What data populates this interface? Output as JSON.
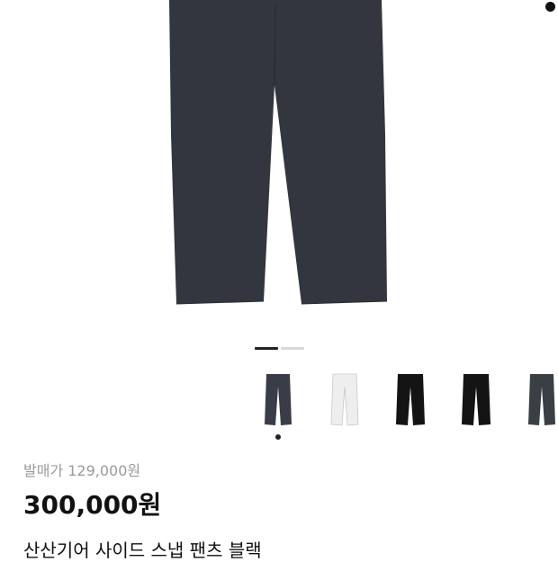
{
  "product": {
    "release_price_label": "발매가 129,000원",
    "price": "300,000원",
    "title": "산산기어 사이드 스냅 팬츠 블랙"
  },
  "gallery": {
    "main_image_color": "#33353f",
    "page_count": 2,
    "current_page": 1
  },
  "thumbnails": [
    {
      "color": "#3a3c47",
      "selected": true
    },
    {
      "color": "#eeeeee",
      "selected": false
    },
    {
      "color": "#141414",
      "selected": false
    },
    {
      "color": "#141414",
      "selected": false
    },
    {
      "color": "#3a3f43",
      "selected": false
    }
  ],
  "colors": {
    "indicator_active": "#222222",
    "indicator_inactive": "#d8d8d8",
    "price": "#111111",
    "release_price": "#9a9a9a"
  }
}
